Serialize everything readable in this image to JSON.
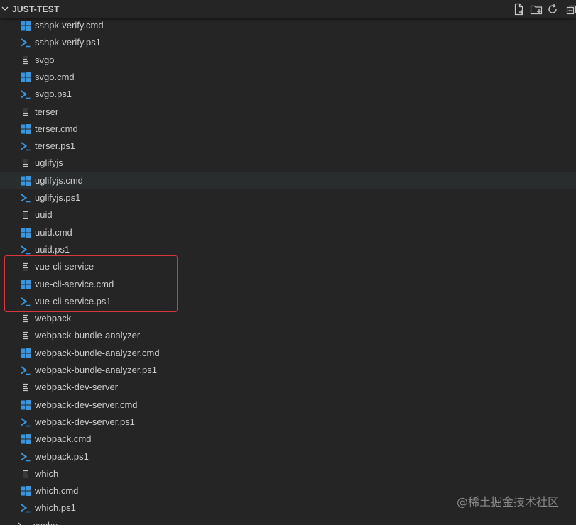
{
  "header": {
    "title": "JUST-TEST",
    "actions": [
      {
        "icon": "new-file-icon"
      },
      {
        "icon": "new-folder-icon"
      },
      {
        "icon": "refresh-icon"
      },
      {
        "icon": "collapse-all-icon"
      }
    ]
  },
  "colors": {
    "background": "#252526",
    "text": "#cccccc",
    "windows_icon": "#3a96dd",
    "powershell_icon": "#3a96dd",
    "file_icon": "#c5c5c5",
    "highlight_box": "#d9363e",
    "hover_row": "#2a2d2e"
  },
  "files": [
    {
      "name": "sshpk-verify.cmd",
      "icon": "windows-icon"
    },
    {
      "name": "sshpk-verify.ps1",
      "icon": "powershell-icon"
    },
    {
      "name": "svgo",
      "icon": "file-lines-icon"
    },
    {
      "name": "svgo.cmd",
      "icon": "windows-icon"
    },
    {
      "name": "svgo.ps1",
      "icon": "powershell-icon"
    },
    {
      "name": "terser",
      "icon": "file-lines-icon"
    },
    {
      "name": "terser.cmd",
      "icon": "windows-icon"
    },
    {
      "name": "terser.ps1",
      "icon": "powershell-icon"
    },
    {
      "name": "uglifyjs",
      "icon": "file-lines-icon"
    },
    {
      "name": "uglifyjs.cmd",
      "icon": "windows-icon",
      "hovered": true
    },
    {
      "name": "uglifyjs.ps1",
      "icon": "powershell-icon"
    },
    {
      "name": "uuid",
      "icon": "file-lines-icon"
    },
    {
      "name": "uuid.cmd",
      "icon": "windows-icon"
    },
    {
      "name": "uuid.ps1",
      "icon": "powershell-icon"
    },
    {
      "name": "vue-cli-service",
      "icon": "file-lines-icon"
    },
    {
      "name": "vue-cli-service.cmd",
      "icon": "windows-icon"
    },
    {
      "name": "vue-cli-service.ps1",
      "icon": "powershell-icon"
    },
    {
      "name": "webpack",
      "icon": "file-lines-icon"
    },
    {
      "name": "webpack-bundle-analyzer",
      "icon": "file-lines-icon"
    },
    {
      "name": "webpack-bundle-analyzer.cmd",
      "icon": "windows-icon"
    },
    {
      "name": "webpack-bundle-analyzer.ps1",
      "icon": "powershell-icon"
    },
    {
      "name": "webpack-dev-server",
      "icon": "file-lines-icon"
    },
    {
      "name": "webpack-dev-server.cmd",
      "icon": "windows-icon"
    },
    {
      "name": "webpack-dev-server.ps1",
      "icon": "powershell-icon"
    },
    {
      "name": "webpack.cmd",
      "icon": "windows-icon"
    },
    {
      "name": "webpack.ps1",
      "icon": "powershell-icon"
    },
    {
      "name": "which",
      "icon": "file-lines-icon"
    },
    {
      "name": "which.cmd",
      "icon": "windows-icon"
    },
    {
      "name": "which.ps1",
      "icon": "powershell-icon"
    }
  ],
  "folders": [
    {
      "name": ".cache",
      "icon": "chevron-right-icon"
    }
  ],
  "watermark": "@稀土掘金技术社区"
}
